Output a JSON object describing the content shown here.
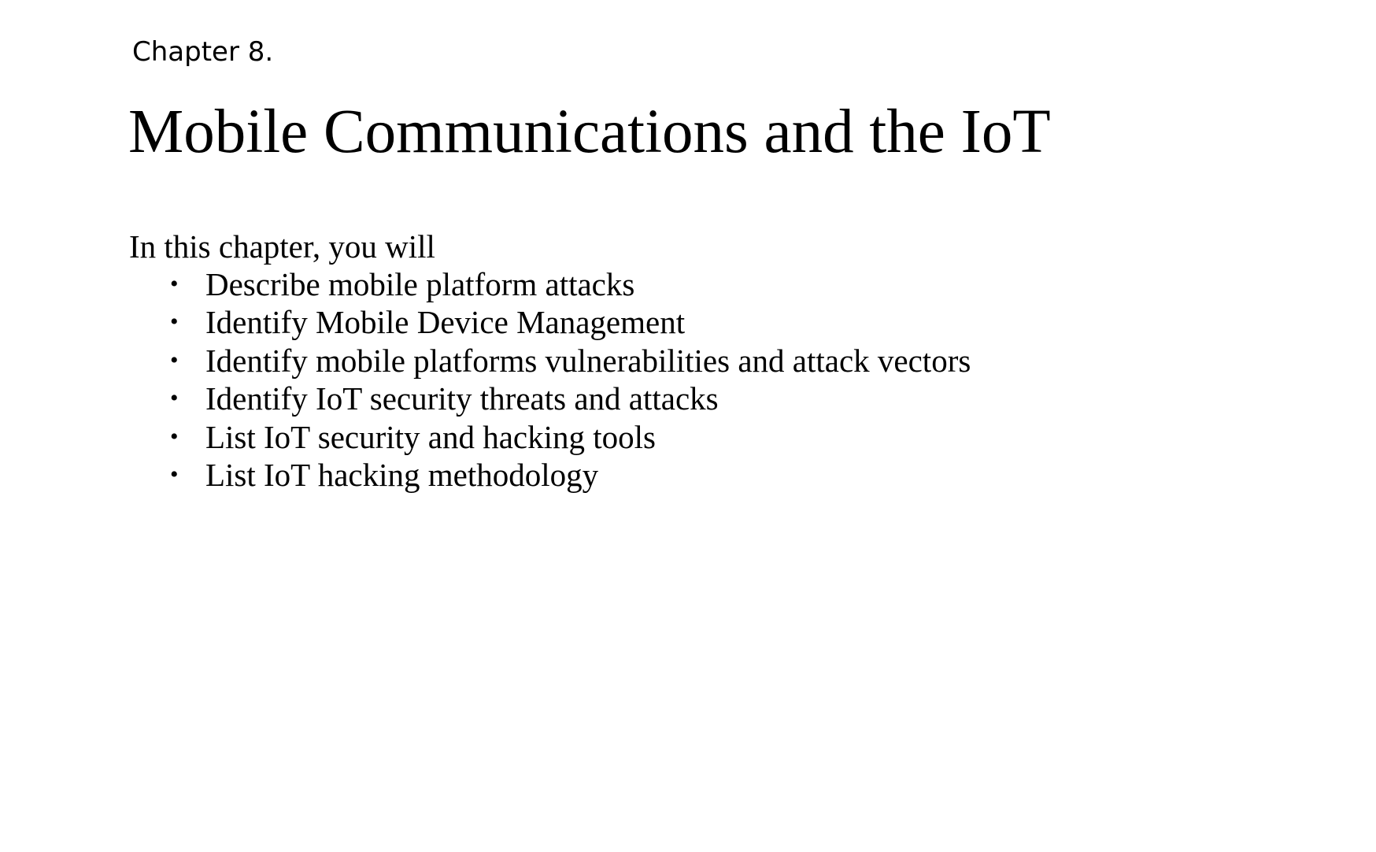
{
  "chapter": {
    "number_label": "Chapter 8.",
    "title": "Mobile Communications and the IoT"
  },
  "intro": "In this chapter, you will",
  "objectives": [
    "Describe mobile platform attacks",
    "Identify Mobile Device Management",
    "Identify mobile platforms vulnerabilities and attack vectors",
    "Identify IoT security threats and attacks",
    "List IoT security and hacking tools",
    "List IoT hacking methodology"
  ],
  "bullet_glyph": "•"
}
